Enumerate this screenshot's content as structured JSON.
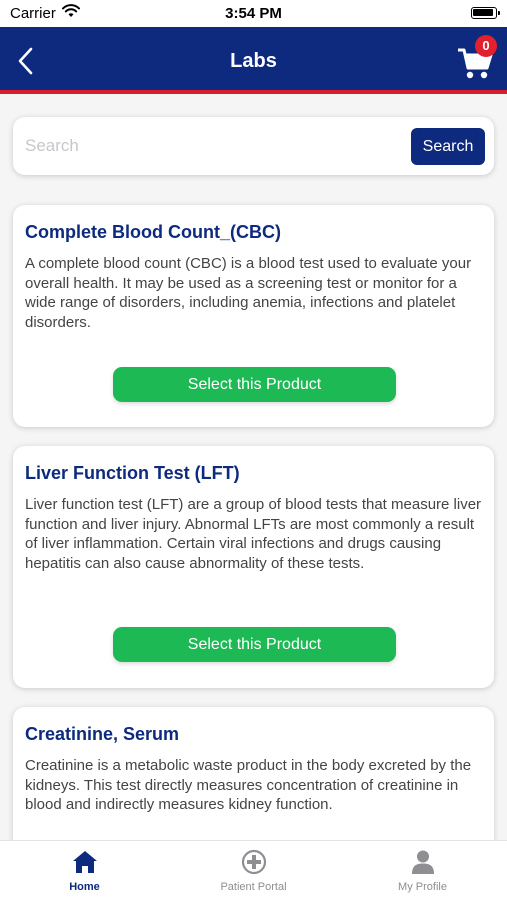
{
  "status_bar": {
    "carrier": "Carrier",
    "time": "3:54 PM"
  },
  "nav": {
    "title": "Labs",
    "cart_count": "0"
  },
  "search": {
    "placeholder": "Search",
    "button_label": "Search"
  },
  "products": [
    {
      "title": "Complete Blood Count_(CBC)",
      "description": "A complete blood count (CBC) is a blood test used to evaluate your overall health. It may be used as a screening test or monitor for a wide range of disorders, including anemia, infections and platelet disorders.",
      "button_label": "Select this Product"
    },
    {
      "title": "Liver Function Test (LFT)",
      "description": "Liver function test (LFT) are a group of blood tests that measure liver function and liver injury. Abnormal LFTs are most commonly a result of liver inflammation. Certain viral infections and drugs causing hepatitis can also cause abnormality of these tests.",
      "button_label": "Select this Product"
    },
    {
      "title": "Creatinine, Serum",
      "description": "Creatinine is a metabolic waste product in the body excreted by the kidneys. This test directly measures concentration of creatinine in blood and indirectly measures kidney function."
    }
  ],
  "tab_bar": {
    "tabs": [
      {
        "label": "Home",
        "icon": "home-icon",
        "active": true
      },
      {
        "label": "Patient Portal",
        "icon": "plus-circle-icon",
        "active": false
      },
      {
        "label": "My Profile",
        "icon": "person-icon",
        "active": false
      }
    ]
  },
  "colors": {
    "primary": "#0e2a7e",
    "accent_red": "#d6202d",
    "button_green": "#1db954",
    "badge_red": "#e2212c"
  }
}
